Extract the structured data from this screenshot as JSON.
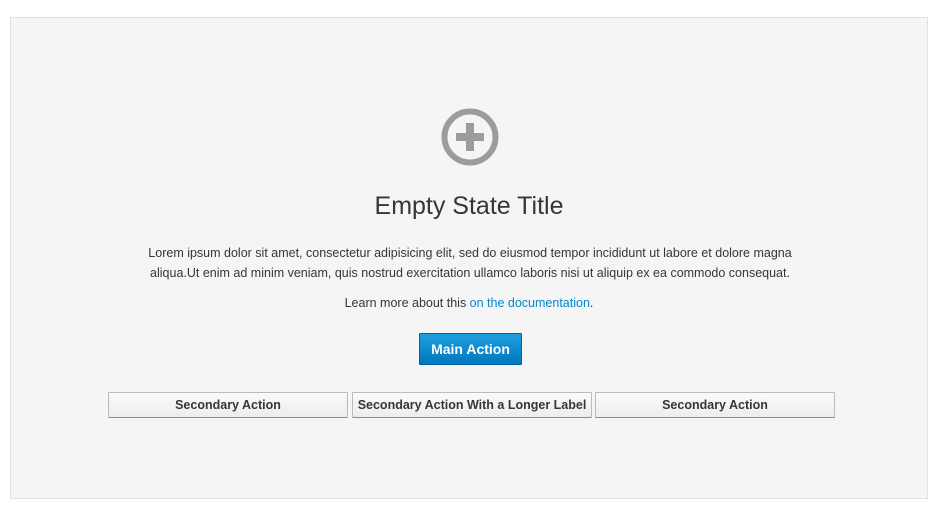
{
  "empty_state": {
    "icon": "add-circle-icon",
    "title": "Empty State Title",
    "body_line1": "Lorem ipsum dolor sit amet, consectetur adipisicing elit, sed do eiusmod tempor incididunt ut labore et dolore magna",
    "body_line2": "aliqua.Ut enim ad minim veniam, quis nostrud exercitation ullamco laboris nisi ut aliquip ex ea commodo consequat.",
    "learn_more_prefix": "Learn more about this ",
    "learn_more_link": "on the documentation",
    "learn_more_suffix": ".",
    "main_action_label": "Main Action",
    "secondary_actions": [
      {
        "label": "Secondary Action"
      },
      {
        "label": "Secondary Action With a Longer Label"
      },
      {
        "label": "Secondary Action"
      }
    ]
  },
  "colors": {
    "background": "#f5f5f5",
    "icon": "#9c9c9c",
    "link": "#0088ce",
    "primary_button": "#0088ce",
    "text": "#363636"
  }
}
